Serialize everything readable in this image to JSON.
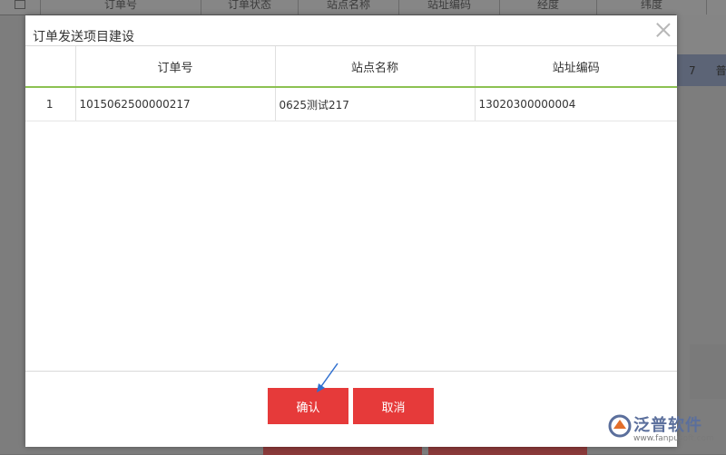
{
  "background": {
    "columns": [
      "",
      "订单号",
      "订单状态",
      "站点名称",
      "站址编码",
      "经度",
      "纬度"
    ],
    "row_fragments": [
      "7",
      "普"
    ]
  },
  "dialog": {
    "title": "订单发送项目建设",
    "table": {
      "headers": [
        "",
        "订单号",
        "站点名称",
        "站址编码"
      ],
      "rows": [
        [
          "1",
          "1015062500000217",
          "0625测试217",
          "13020300000004"
        ]
      ]
    },
    "buttons": {
      "confirm": "确认",
      "cancel": "取消"
    }
  },
  "logo": {
    "name": "泛普软件",
    "url": "www.fanpusoft.com"
  },
  "colors": {
    "accent_red": "#e63a3a",
    "header_underline": "#8cc152",
    "logo_blue": "#5b6f9c"
  }
}
